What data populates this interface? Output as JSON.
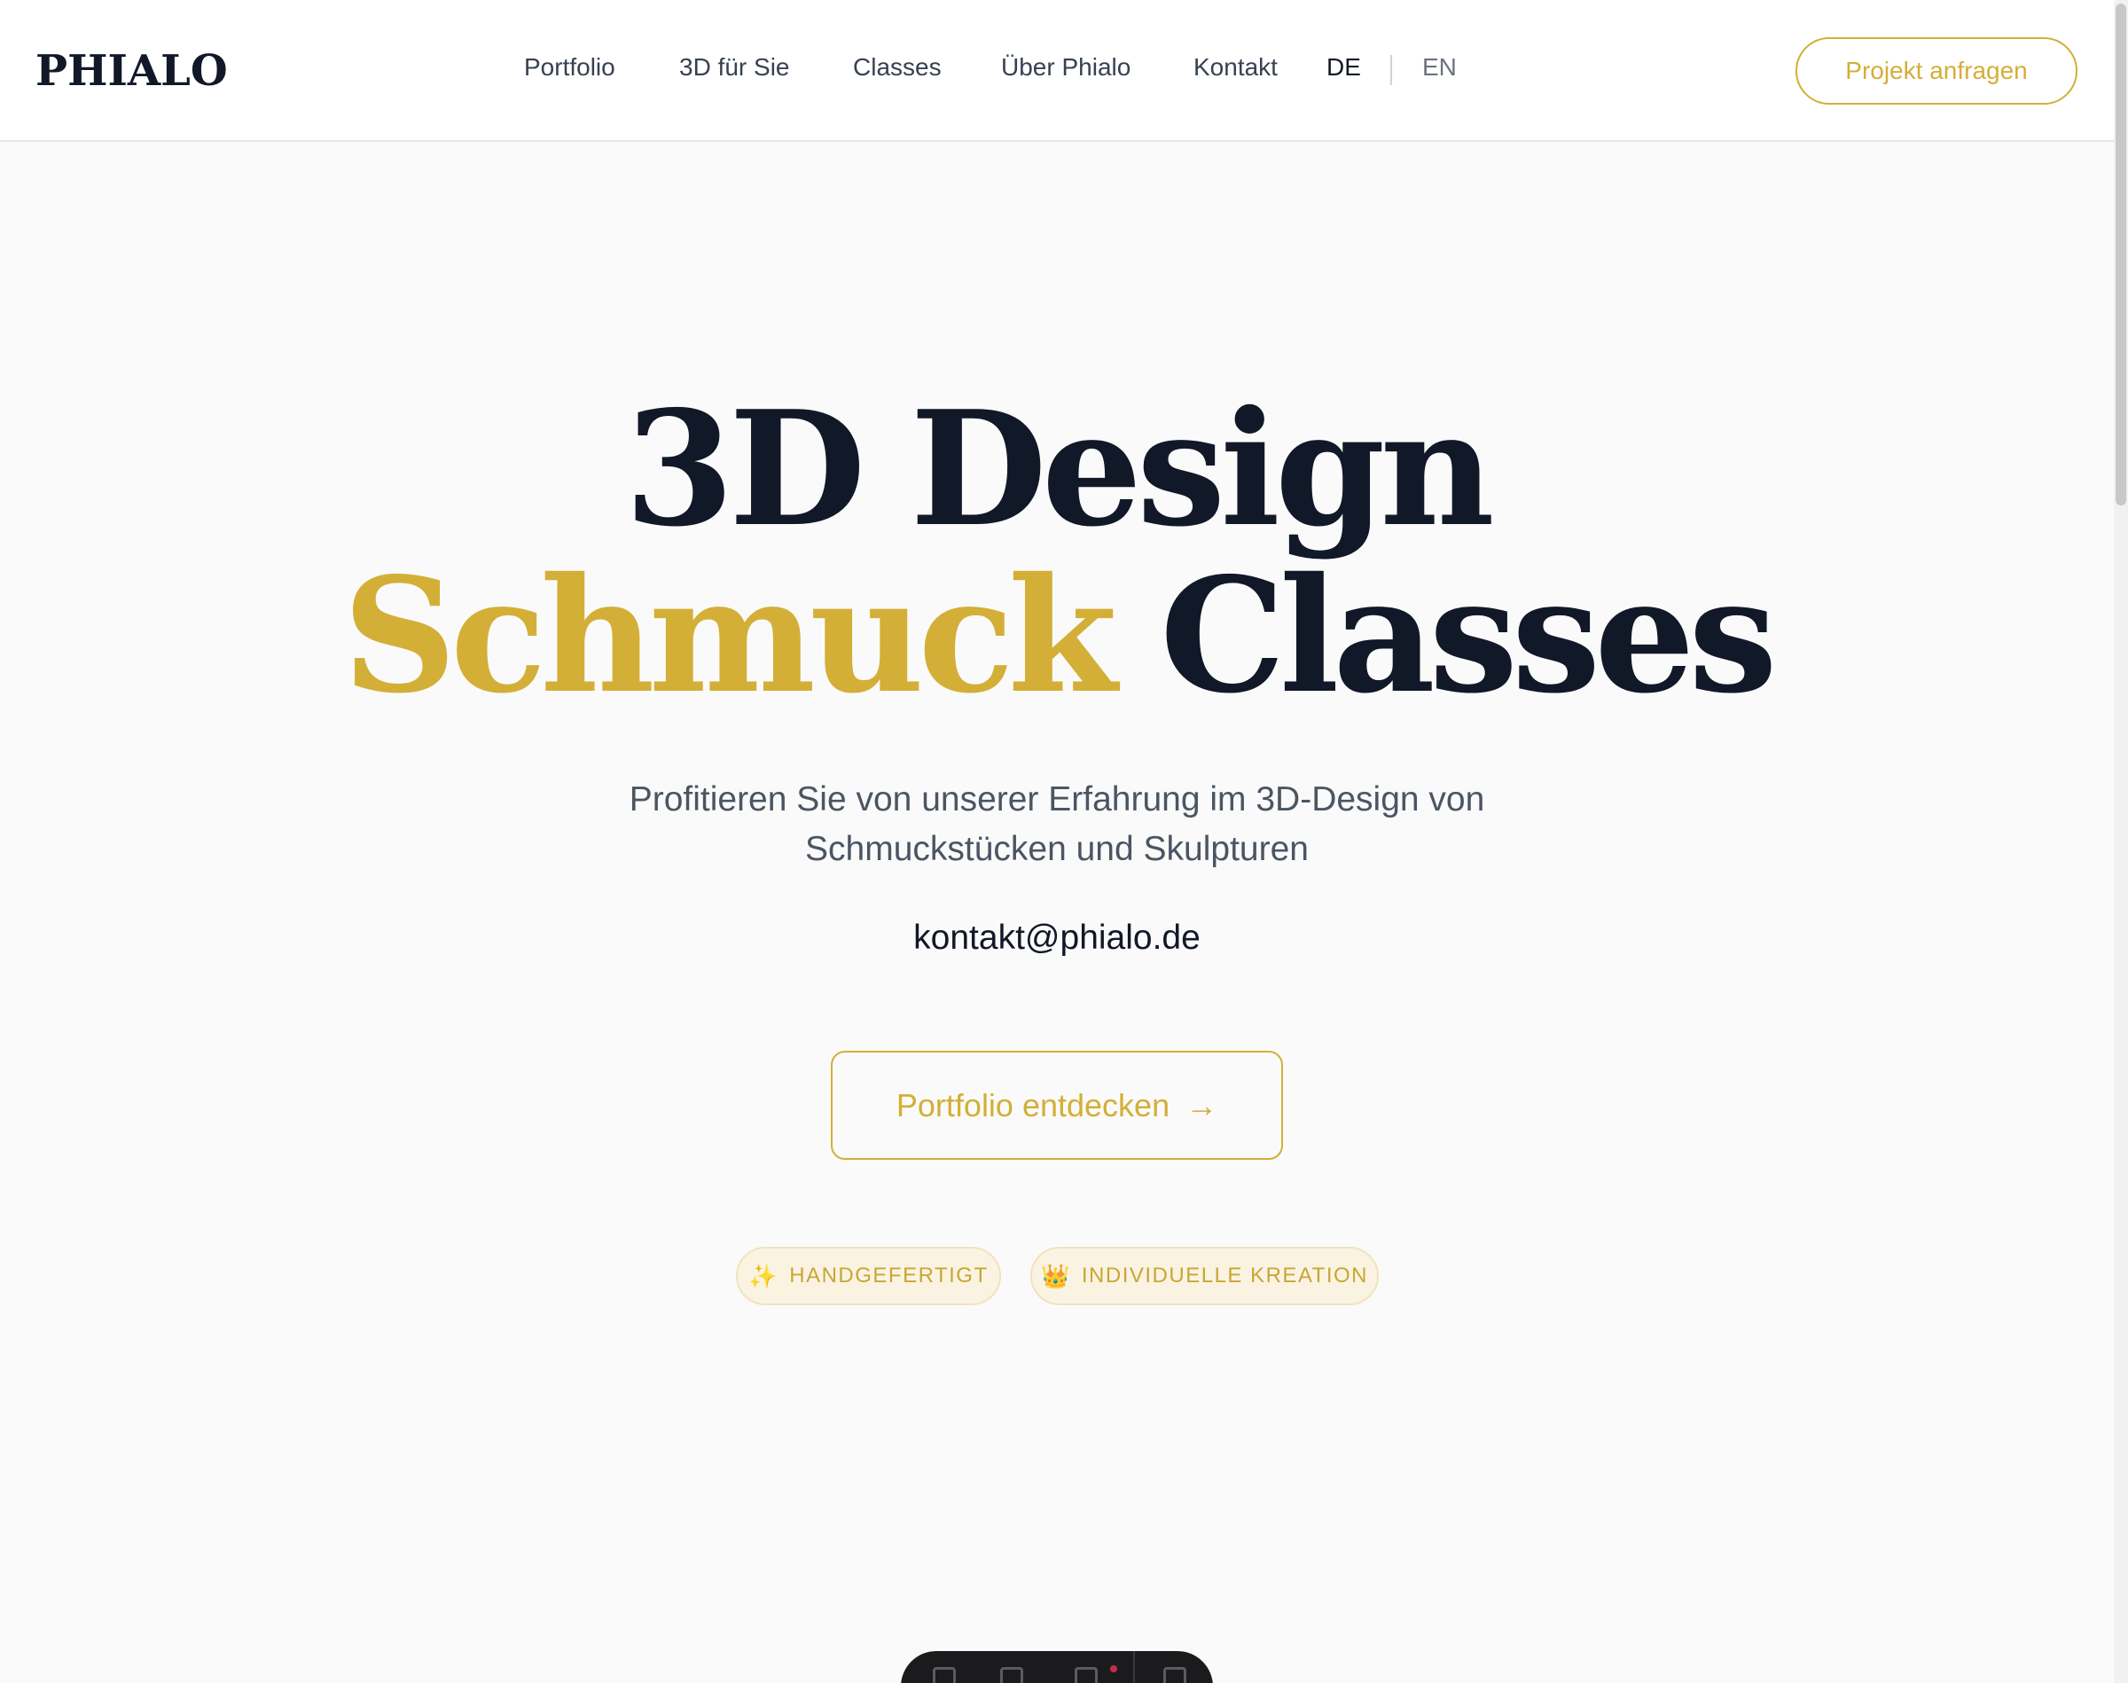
{
  "header": {
    "logo": "PHIALO",
    "nav": [
      "Portfolio",
      "3D für Sie",
      "Classes",
      "Über Phialo",
      "Kontakt"
    ],
    "lang_active": "DE",
    "lang_other": "EN",
    "cta": "Projekt anfragen"
  },
  "hero": {
    "title_line1": "3D Design",
    "title_line2_gold": "Schmuck",
    "title_line2_rest": "Classes",
    "subtitle_line1": "Profitieren Sie von unserer Erfahrung im 3D-Design von",
    "subtitle_line2": "Schmuckstücken und Skulpturen",
    "email": "kontakt@phialo.de",
    "cta_label": "Portfolio entdecken",
    "cta_arrow": "→",
    "badges": [
      {
        "icon": "sparkles-icon",
        "glyph": "✨",
        "label": "HANDGEFERTIGT"
      },
      {
        "icon": "crown-icon",
        "glyph": "👑",
        "label": "INDIVIDUELLE KREATION"
      }
    ]
  },
  "colors": {
    "gold": "#d3af37",
    "dark": "#111827",
    "muted": "#4b5563",
    "background": "#fafafa"
  }
}
